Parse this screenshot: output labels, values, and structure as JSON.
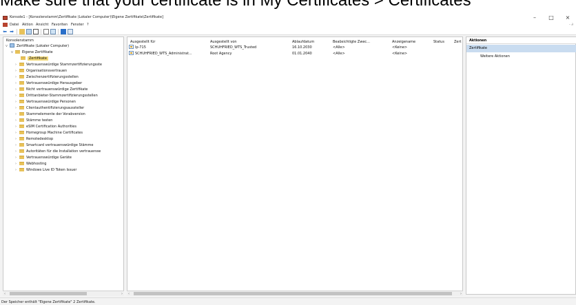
{
  "caption": "Make sure that your certificate is in My Certificates > Certificates",
  "window": {
    "title": "Konsole1 - [Konsolenstamm\\Zertifikate (Lokaler Computer)\\Eigene Zertifikate\\Zertifikate]",
    "min": "–",
    "max": "□",
    "close": "×"
  },
  "menu": {
    "items": [
      "Datei",
      "Aktion",
      "Ansicht",
      "Favoriten",
      "Fenster",
      "?"
    ],
    "right": "- ∂"
  },
  "toolbar": {
    "back_icon": "arrow-left-icon",
    "forward_icon": "arrow-right-icon",
    "back": "⬅",
    "forward": "➡"
  },
  "tree": {
    "root": "Konsolenstamm",
    "computer": "Zertifikate (Lokaler Computer)",
    "personal": "Eigene Zertifikate",
    "selected": "Zertifikate",
    "stores": [
      "Vertrauenswürdige Stammzertifizierungsste",
      "Organisationsvertrauen",
      "Zwischenzertifizierungsstellen",
      "Vertrauenswürdige Herausgeber",
      "Nicht vertrauenswürdige Zertifikate",
      "Drittanbieter-Stammzertifizierungsstellen",
      "Vertrauenswürdige Personen",
      "Clientauthentifizierungsaussteller",
      "Stammelemente der Vorabversion",
      "Stämme testen",
      "eSIM Certification Authorities",
      "Homegroup Machine Certificates",
      "Remotedesktop",
      "Smartcard vertrauenswürdige Stämme",
      "Autoritäten für die Installation vertrauensw",
      "Vertrauenswürdige Geräte",
      "Webhosting",
      "Windows Live ID Token Issuer"
    ]
  },
  "list": {
    "columns": [
      "Ausgestellt für",
      "Ausgestellt von",
      "Ablaufdatum",
      "Beabsichtigte Zwec...",
      "Anzeigename",
      "Status",
      "Zert"
    ],
    "rows": [
      [
        "lp-715",
        "SCHUHFRIED_WTS_Trusted",
        "16.10.2030",
        "<Alle>",
        "<Keine>"
      ],
      [
        "SCHUHFRIED_WTS_Administrat...",
        "Root Agency",
        "01.01.2040",
        "<Alle>",
        "<Keine>"
      ]
    ]
  },
  "actions": {
    "header": "Aktionen",
    "section": "Zertifikate",
    "item": "Weitere Aktionen"
  },
  "status": {
    "text": "Der Speicher enthält \"Eigene Zertifikate\" 2 Zertifikate."
  }
}
